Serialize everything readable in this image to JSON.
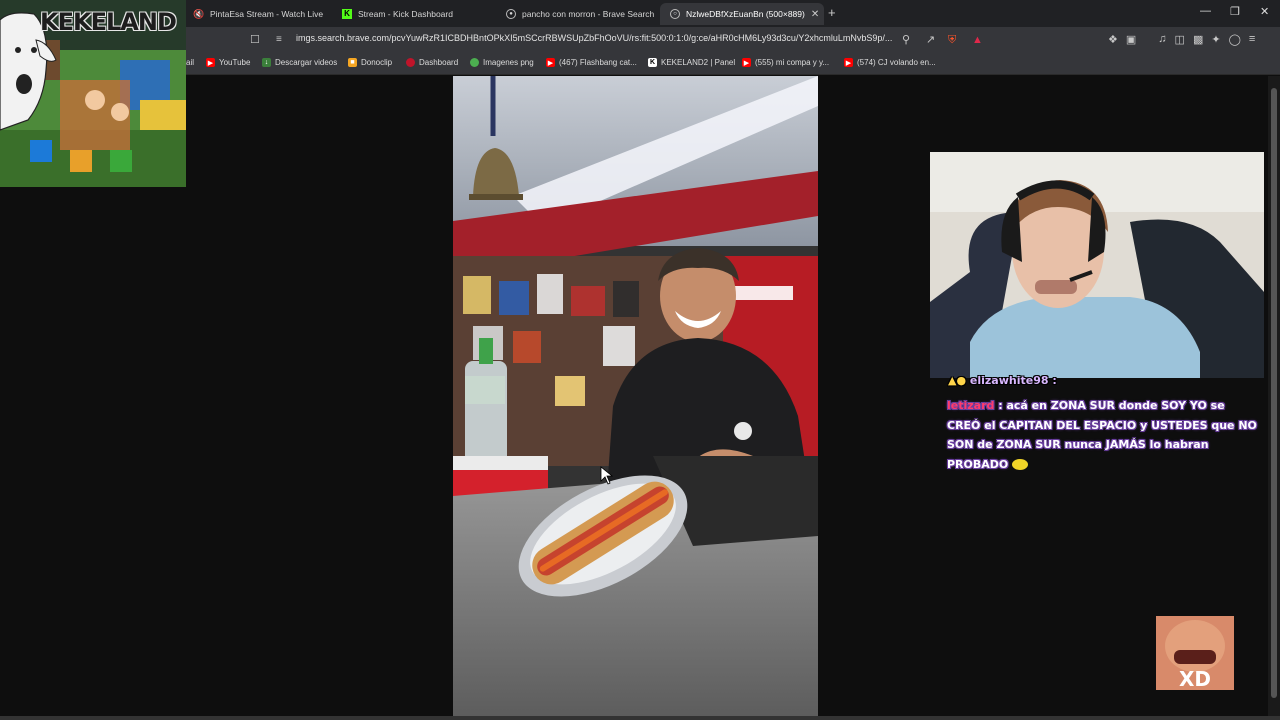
{
  "tabs": [
    {
      "title": "PintaEsa Stream - Watch Live on",
      "icon": "kick-muted-icon",
      "active": false
    },
    {
      "title": "Stream - Kick Dashboard",
      "icon": "kick-icon",
      "active": false
    },
    {
      "title": "pancho con morron - Brave Search",
      "icon": "brave-search-icon",
      "active": false
    },
    {
      "title": "NzlweDBfXzEuanBn (500×889)",
      "icon": "globe-icon",
      "active": true
    }
  ],
  "address_bar": {
    "url": "imgs.search.brave.com/pcvYuwRzR1ICBDHBntOPkXI5mSCcrRBWSUpZbFhOoVU/rs:fit:500:0:1:0/g:ce/aHR0cHM6Ly93d3cu/Y2xhcmluLmNvbS9p/..."
  },
  "bookmarks": [
    {
      "label": "ail",
      "icon": "gmail-icon"
    },
    {
      "label": "YouTube",
      "icon": "youtube-icon"
    },
    {
      "label": "Descargar videos",
      "icon": "download-icon"
    },
    {
      "label": "Donoclip",
      "icon": "donoclip-icon"
    },
    {
      "label": "Dashboard",
      "icon": "dashboard-icon"
    },
    {
      "label": "Imagenes png",
      "icon": "image-icon"
    },
    {
      "label": "(467) Flashbang cat...",
      "icon": "youtube-icon"
    },
    {
      "label": "KEKELAND2 | Panel",
      "icon": "k-icon"
    },
    {
      "label": "(555) mi compa y y...",
      "icon": "youtube-icon"
    },
    {
      "label": "(574) CJ volando en...",
      "icon": "youtube-icon"
    }
  ],
  "overlay": {
    "logo_text": "KEKELAND",
    "chat": {
      "prev_user": "elizawhite98 :",
      "user": "letizard",
      "message": ": acá en ZONA SUR donde SOY YO se CREÓ el CAPITAN DEL ESPACIO y USTEDES que NO SON de ZONA SUR nunca JAMÁS lo habran PROBADO"
    }
  },
  "colors": {
    "tab_bar": "#202124",
    "toolbar": "#35363a",
    "chat_user": "#ff3b6b",
    "chat_text": "#ffffff",
    "chat_outline": "#6a3fa0",
    "youtube_red": "#ff0000",
    "kick_green": "#53fc18"
  }
}
